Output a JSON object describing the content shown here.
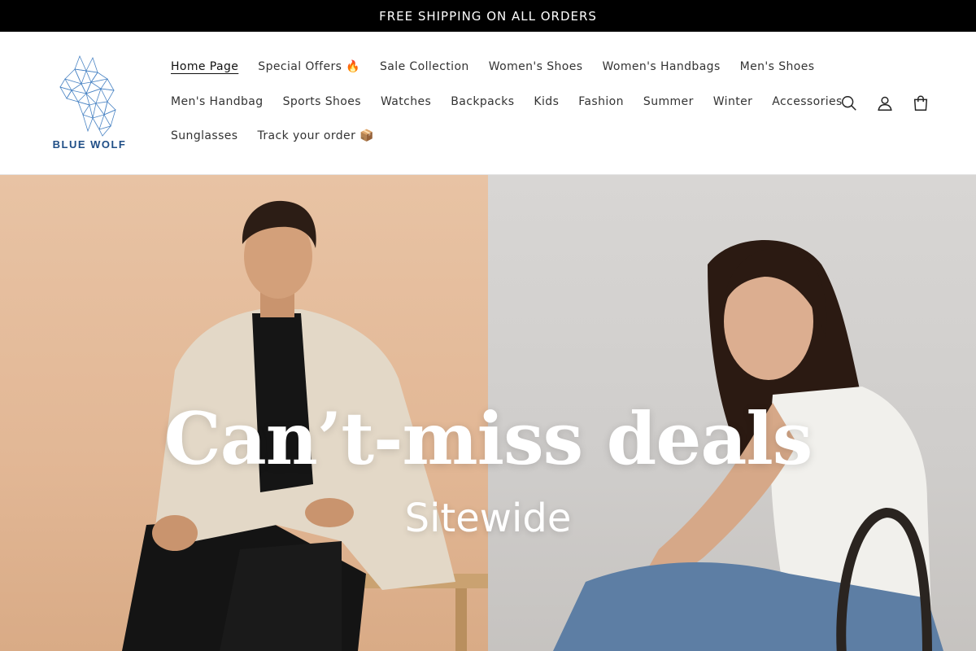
{
  "announcement": {
    "text": "FREE SHIPPING ON ALL ORDERS"
  },
  "brand": {
    "name": "BLUE WOLF",
    "color": "#1f4e86"
  },
  "nav": {
    "rows": [
      [
        {
          "label": "Home Page",
          "active": true
        },
        {
          "label": "Special Offers 🔥"
        },
        {
          "label": "Sale Collection"
        },
        {
          "label": "Women's Shoes"
        },
        {
          "label": "Women's Handbags"
        },
        {
          "label": "Men's Shoes"
        }
      ],
      [
        {
          "label": "Men's Handbag"
        },
        {
          "label": "Sports Shoes"
        },
        {
          "label": "Watches"
        },
        {
          "label": "Backpacks"
        },
        {
          "label": "Kids"
        },
        {
          "label": "Fashion"
        },
        {
          "label": "Summer"
        },
        {
          "label": "Winter"
        },
        {
          "label": "Accessories"
        }
      ],
      [
        {
          "label": "Sunglasses"
        },
        {
          "label": "Track your order 📦"
        }
      ]
    ]
  },
  "header_icons": [
    "search-icon",
    "account-icon",
    "cart-icon"
  ],
  "hero": {
    "title": "Can’t-miss deals",
    "subtitle": "Sitewide"
  }
}
